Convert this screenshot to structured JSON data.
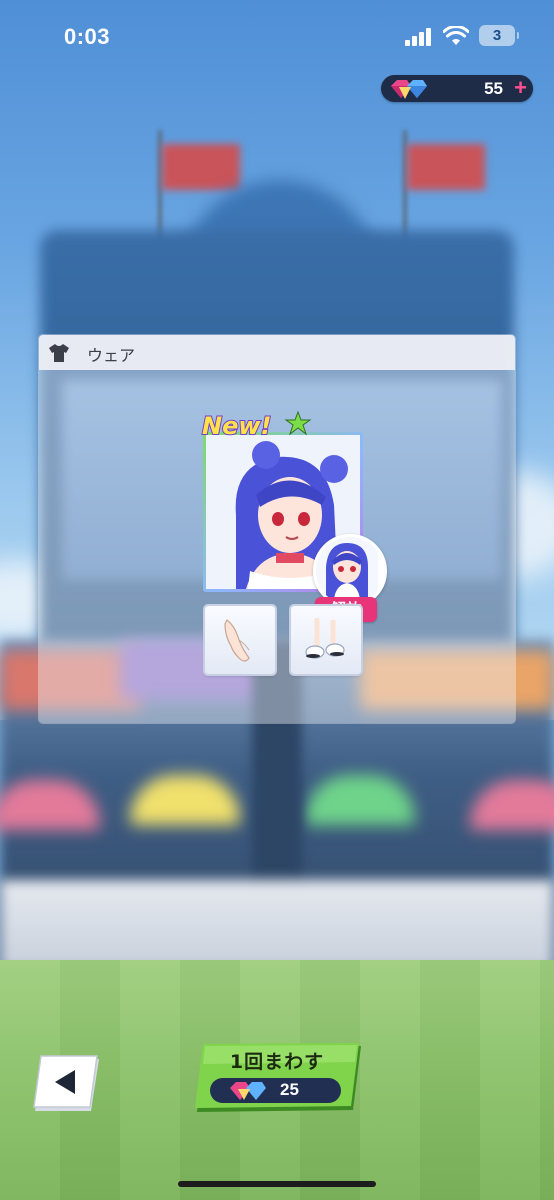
{
  "status_bar": {
    "time": "0:03",
    "battery_level": "3"
  },
  "currency": {
    "gem_count": "55",
    "plus_symbol": "+",
    "icon": "gem-icon"
  },
  "wear_panel": {
    "title": "ウェア",
    "header_icon": "shirt-icon",
    "new_badge": "New!",
    "unlock_label": "解放",
    "items": [
      "gloves-icon",
      "shoes-icon"
    ]
  },
  "spin": {
    "label": "1回まわす",
    "cost": "25",
    "cost_icon": "gem-icon"
  },
  "colors": {
    "accent_pink": "#e8357a",
    "button_green": "#7fd34a",
    "pill_navy": "#1f2c48",
    "hair_blue": "#4a52d8"
  }
}
